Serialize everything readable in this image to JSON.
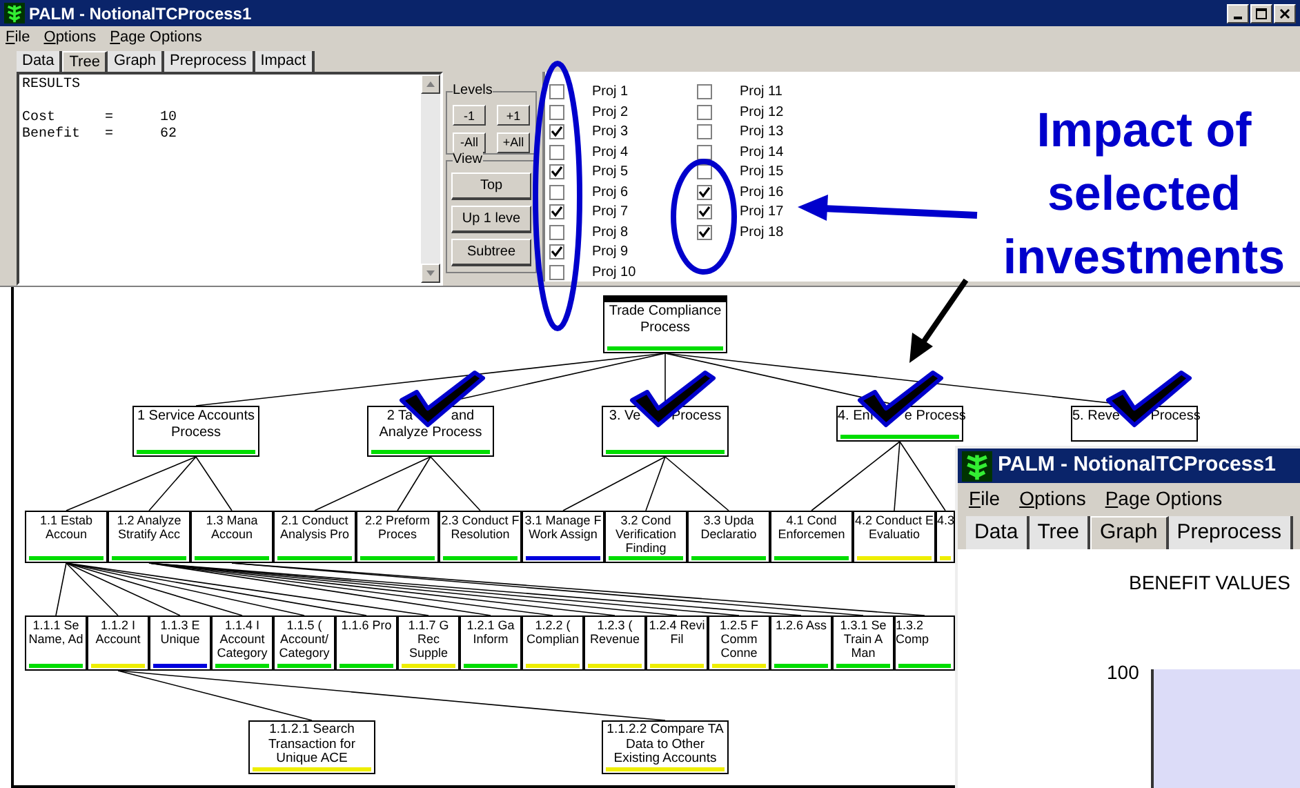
{
  "window": {
    "title": "PALM - NotionalTCProcess1"
  },
  "menu": [
    "File",
    "Options",
    "Page Options"
  ],
  "tabs": [
    {
      "label": "Data",
      "selected": false
    },
    {
      "label": "Tree",
      "selected": true
    },
    {
      "label": "Graph",
      "selected": false
    },
    {
      "label": "Preprocess",
      "selected": false
    },
    {
      "label": "Impact",
      "selected": false
    }
  ],
  "results": {
    "heading": "RESULTS",
    "rows": [
      {
        "label": "Cost",
        "sign": "=",
        "value": "10"
      },
      {
        "label": "Benefit",
        "sign": "=",
        "value": "62"
      }
    ]
  },
  "levels": {
    "title": "Levels",
    "buttons": [
      "-1",
      "+1",
      "-All",
      "+All"
    ]
  },
  "view": {
    "title": "View",
    "buttons": [
      "Top",
      "Up 1 leve",
      "Subtree"
    ]
  },
  "projects": [
    {
      "label": "Proj 1",
      "checked": false
    },
    {
      "label": "Proj 2",
      "checked": false
    },
    {
      "label": "Proj 3",
      "checked": true
    },
    {
      "label": "Proj 4",
      "checked": false
    },
    {
      "label": "Proj 5",
      "checked": true
    },
    {
      "label": "Proj 6",
      "checked": false
    },
    {
      "label": "Proj 7",
      "checked": true
    },
    {
      "label": "Proj 8",
      "checked": false
    },
    {
      "label": "Proj 9",
      "checked": true
    },
    {
      "label": "Proj 10",
      "checked": false
    },
    {
      "label": "Proj 11",
      "checked": false
    },
    {
      "label": "Proj 12",
      "checked": false
    },
    {
      "label": "Proj 13",
      "checked": false
    },
    {
      "label": "Proj 14",
      "checked": false
    },
    {
      "label": "Proj 15",
      "checked": false
    },
    {
      "label": "Proj 16",
      "checked": true
    },
    {
      "label": "Proj 17",
      "checked": true
    },
    {
      "label": "Proj 18",
      "checked": true
    }
  ],
  "tree": {
    "lines": [
      "Trade Compliance",
      "Process"
    ],
    "color": "#00dd00",
    "children": [
      {
        "lines": [
          "1 Service Accounts",
          "Process"
        ],
        "color": "#00dd00",
        "children": [
          {
            "lines": [
              "1.1 Estab",
              "Accoun"
            ],
            "color": "#00dd00",
            "children": [
              {
                "lines": [
                  "1.1.1 Se",
                  "Name, Ad"
                ],
                "color": "#00dd00"
              },
              {
                "lines": [
                  "1.1.2 I",
                  "Account"
                ],
                "color": "#eeee00",
                "children": [
                  {
                    "lines": [
                      "1.1.2.1 Search",
                      "Transaction for",
                      "Unique ACE"
                    ],
                    "color": "#eeee00"
                  },
                  {
                    "lines": [
                      "1.1.2.2 Compare TA",
                      "Data to Other",
                      "Existing Accounts"
                    ],
                    "color": "#eeee00"
                  }
                ]
              },
              {
                "lines": [
                  "1.1.3 E",
                  "Unique"
                ],
                "color": "#0000dd"
              },
              {
                "lines": [
                  "1.1.4 I",
                  "Account",
                  "Category"
                ],
                "color": "#00dd00"
              },
              {
                "lines": [
                  "1.1.5 (",
                  "Account/",
                  "Category"
                ],
                "color": "#00dd00"
              },
              {
                "lines": [
                  "1.1.6 Pro"
                ],
                "color": "#00dd00"
              },
              {
                "lines": [
                  "1.1.7 G",
                  "Rec",
                  "Supple"
                ],
                "color": "#eeee00"
              }
            ]
          },
          {
            "lines": [
              "1.2 Analyze",
              "Stratify Acc"
            ],
            "color": "#00dd00",
            "children": [
              {
                "lines": [
                  "1.2.1 Ga",
                  "Inform"
                ],
                "color": "#00dd00"
              },
              {
                "lines": [
                  "1.2.2 (",
                  "Complian"
                ],
                "color": "#eeee00"
              },
              {
                "lines": [
                  "1.2.3 (",
                  "Revenue"
                ],
                "color": "#eeee00"
              },
              {
                "lines": [
                  "1.2.4 Revi",
                  "Fil"
                ],
                "color": "#eeee00"
              },
              {
                "lines": [
                  "1.2.5 F",
                  "Comm",
                  "Conne"
                ],
                "color": "#eeee00"
              },
              {
                "lines": [
                  "1.2.6 Ass"
                ],
                "color": "#00dd00"
              }
            ]
          },
          {
            "lines": [
              "1.3 Mana",
              "Accoun"
            ],
            "color": "#00dd00",
            "children": [
              {
                "lines": [
                  "1.3.1 Se",
                  "Train A",
                  "Man"
                ],
                "color": "#00dd00"
              },
              {
                "lines": [
                  "1.3.2",
                  "Comp"
                ],
                "color": "#00dd00"
              }
            ]
          }
        ]
      },
      {
        "lines": [
          "2 Ta          and",
          "Analyze Process"
        ],
        "color": "#00dd00",
        "children": [
          {
            "lines": [
              "2.1 Conduct",
              "Analysis Pro"
            ],
            "color": "#00dd00"
          },
          {
            "lines": [
              "2.2 Preform",
              "Proces"
            ],
            "color": "#00dd00"
          },
          {
            "lines": [
              "2.3 Conduct F",
              "Resolution"
            ],
            "color": "#00dd00"
          }
        ]
      },
      {
        "lines": [
          "3. Ve        Process"
        ],
        "color": "#00dd00",
        "children": [
          {
            "lines": [
              "3.1 Manage F",
              "Work Assign"
            ],
            "color": "#0000dd"
          },
          {
            "lines": [
              "3.2 Cond",
              "Verification",
              "Finding"
            ],
            "color": "#00dd00"
          },
          {
            "lines": [
              "3.3 Upda",
              "Declaratio"
            ],
            "color": "#00dd00"
          }
        ]
      },
      {
        "lines": [
          "4. Enf        e Process"
        ],
        "color": "#00dd00",
        "children": [
          {
            "lines": [
              "4.1 Cond",
              "Enforcemen"
            ],
            "color": "#00dd00"
          },
          {
            "lines": [
              "4.2 Conduct E",
              "Evaluatio"
            ],
            "color": "#eeee00"
          },
          {
            "lines": [
              "4.3"
            ],
            "color": "#eeee00"
          }
        ]
      },
      {
        "lines": [
          "5. Reve        Process"
        ]
      }
    ]
  },
  "annotation": {
    "lines": [
      "Impact of",
      "selected",
      "investments"
    ]
  },
  "inset_window": {
    "title": "PALM - NotionalTCProcess1",
    "menu": [
      "File",
      "Options",
      "Page Options"
    ],
    "tabs": [
      {
        "label": "Data",
        "selected": false
      },
      {
        "label": "Tree",
        "selected": false
      },
      {
        "label": "Graph",
        "selected": true
      },
      {
        "label": "Preprocess",
        "selected": false
      }
    ],
    "chart_title": "BENEFIT VALUES",
    "y_label": "100"
  }
}
